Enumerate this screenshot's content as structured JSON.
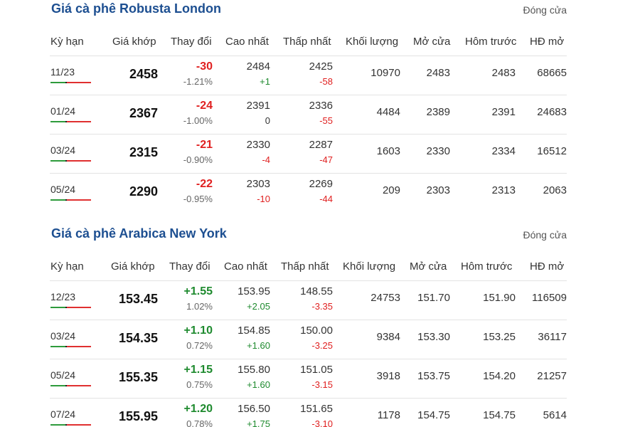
{
  "colors": {
    "title": "#1d4f91",
    "negative": "#e02020",
    "positive": "#1e8a2e"
  },
  "columns": [
    "Kỳ hạn",
    "Giá khớp",
    "Thay đổi",
    "Cao nhất",
    "Thấp nhất",
    "Khối lượng",
    "Mở cửa",
    "Hôm trước",
    "HĐ mở"
  ],
  "robusta": {
    "title": "Giá cà phê Robusta London",
    "status": "Đóng cửa",
    "rows": [
      {
        "term": "11/23",
        "price": "2458",
        "change": "-30",
        "change_pct": "-1.21%",
        "high": "2484",
        "high_diff": "+1",
        "low": "2425",
        "low_diff": "-58",
        "volume": "10970",
        "open": "2483",
        "prev": "2483",
        "oi": "68665"
      },
      {
        "term": "01/24",
        "price": "2367",
        "change": "-24",
        "change_pct": "-1.00%",
        "high": "2391",
        "high_diff": "0",
        "low": "2336",
        "low_diff": "-55",
        "volume": "4484",
        "open": "2389",
        "prev": "2391",
        "oi": "24683"
      },
      {
        "term": "03/24",
        "price": "2315",
        "change": "-21",
        "change_pct": "-0.90%",
        "high": "2330",
        "high_diff": "-4",
        "low": "2287",
        "low_diff": "-47",
        "volume": "1603",
        "open": "2330",
        "prev": "2334",
        "oi": "16512"
      },
      {
        "term": "05/24",
        "price": "2290",
        "change": "-22",
        "change_pct": "-0.95%",
        "high": "2303",
        "high_diff": "-10",
        "low": "2269",
        "low_diff": "-44",
        "volume": "209",
        "open": "2303",
        "prev": "2313",
        "oi": "2063"
      }
    ]
  },
  "arabica": {
    "title": "Giá cà phê Arabica New York",
    "status": "Đóng cửa",
    "rows": [
      {
        "term": "12/23",
        "price": "153.45",
        "change": "+1.55",
        "change_pct": "1.02%",
        "high": "153.95",
        "high_diff": "+2.05",
        "low": "148.55",
        "low_diff": "-3.35",
        "volume": "24753",
        "open": "151.70",
        "prev": "151.90",
        "oi": "116509"
      },
      {
        "term": "03/24",
        "price": "154.35",
        "change": "+1.10",
        "change_pct": "0.72%",
        "high": "154.85",
        "high_diff": "+1.60",
        "low": "150.00",
        "low_diff": "-3.25",
        "volume": "9384",
        "open": "153.30",
        "prev": "153.25",
        "oi": "36117"
      },
      {
        "term": "05/24",
        "price": "155.35",
        "change": "+1.15",
        "change_pct": "0.75%",
        "high": "155.80",
        "high_diff": "+1.60",
        "low": "151.05",
        "low_diff": "-3.15",
        "volume": "3918",
        "open": "153.75",
        "prev": "154.20",
        "oi": "21257"
      },
      {
        "term": "07/24",
        "price": "155.95",
        "change": "+1.20",
        "change_pct": "0.78%",
        "high": "156.50",
        "high_diff": "+1.75",
        "low": "151.65",
        "low_diff": "-3.10",
        "volume": "1178",
        "open": "154.75",
        "prev": "154.75",
        "oi": "5614"
      }
    ]
  }
}
